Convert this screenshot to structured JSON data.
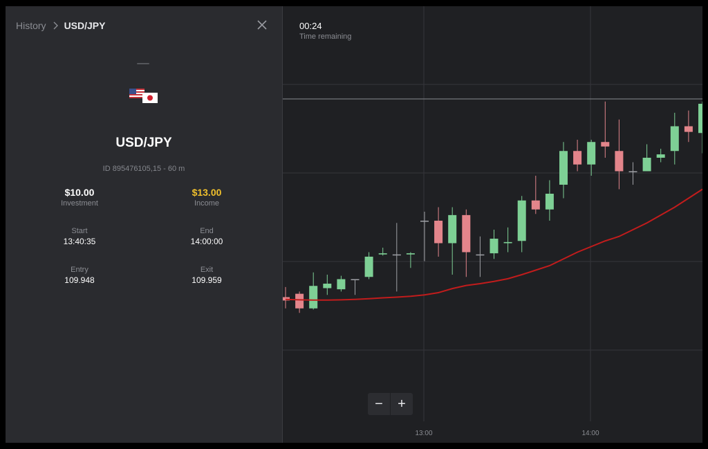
{
  "breadcrumb": {
    "root": "History",
    "current": "USD/JPY"
  },
  "icons": {
    "chevron": "chevron-right-icon",
    "close": "close-icon",
    "flags": "us-jp-flags-icon"
  },
  "trade": {
    "pair": "USD/JPY",
    "id_line": "ID 895476105,15 - 60 m",
    "investment": {
      "value": "$10.00",
      "label": "Investment"
    },
    "income": {
      "value": "$13.00",
      "label": "Income"
    },
    "start": {
      "label": "Start",
      "value": "13:40:35"
    },
    "end": {
      "label": "End",
      "value": "14:00:00"
    },
    "entry": {
      "label": "Entry",
      "value": "109.948"
    },
    "exit": {
      "label": "Exit",
      "value": "109.959"
    }
  },
  "timer": {
    "time": "00:24",
    "label": "Time remaining"
  },
  "zoom": {
    "minus": "−",
    "plus": "+"
  },
  "colors": {
    "up": "#7ed095",
    "down": "#e3858b",
    "ma": "#c21c1c",
    "income": "#f0c02c"
  },
  "chart_data": {
    "type": "candlestick",
    "x_tick_labels": [
      "13:00",
      "14:00"
    ],
    "candles": [
      {
        "o": 0.6,
        "c": 0.45,
        "h": 1.05,
        "l": 0.1
      },
      {
        "o": 0.75,
        "c": 0.1,
        "h": 0.85,
        "l": -0.1
      },
      {
        "o": 0.1,
        "c": 1.1,
        "h": 1.7,
        "l": 0.05
      },
      {
        "o": 1.0,
        "c": 1.2,
        "h": 1.6,
        "l": 0.7
      },
      {
        "o": 0.95,
        "c": 1.4,
        "h": 1.55,
        "l": 0.85
      },
      {
        "o": 1.4,
        "c": 1.4,
        "h": 1.4,
        "l": 0.7
      },
      {
        "o": 1.5,
        "c": 2.4,
        "h": 2.6,
        "l": 1.4
      },
      {
        "o": 2.5,
        "c": 2.55,
        "h": 2.8,
        "l": 2.45
      },
      {
        "o": 2.5,
        "c": 2.5,
        "h": 3.9,
        "l": 0.85
      },
      {
        "o": 2.5,
        "c": 2.55,
        "h": 2.6,
        "l": 1.9
      },
      {
        "o": 4.0,
        "c": 4.0,
        "h": 4.4,
        "l": 2.2
      },
      {
        "o": 4.0,
        "c": 3.0,
        "h": 4.6,
        "l": 2.4
      },
      {
        "o": 3.0,
        "c": 4.25,
        "h": 4.6,
        "l": 1.6
      },
      {
        "o": 4.25,
        "c": 2.6,
        "h": 4.5,
        "l": 1.5
      },
      {
        "o": 2.5,
        "c": 2.5,
        "h": 3.3,
        "l": 1.5
      },
      {
        "o": 2.55,
        "c": 3.2,
        "h": 3.6,
        "l": 2.3
      },
      {
        "o": 3.0,
        "c": 3.05,
        "h": 3.7,
        "l": 2.6
      },
      {
        "o": 3.1,
        "c": 4.9,
        "h": 5.1,
        "l": 2.6
      },
      {
        "o": 4.9,
        "c": 4.5,
        "h": 6.0,
        "l": 4.3
      },
      {
        "o": 4.5,
        "c": 5.2,
        "h": 5.8,
        "l": 4.0
      },
      {
        "o": 5.6,
        "c": 7.1,
        "h": 7.5,
        "l": 5.0
      },
      {
        "o": 7.1,
        "c": 6.5,
        "h": 7.6,
        "l": 6.2
      },
      {
        "o": 6.5,
        "c": 7.5,
        "h": 7.6,
        "l": 6.0
      },
      {
        "o": 7.5,
        "c": 7.3,
        "h": 9.3,
        "l": 6.8
      },
      {
        "o": 7.1,
        "c": 6.2,
        "h": 8.5,
        "l": 5.4
      },
      {
        "o": 6.2,
        "c": 6.2,
        "h": 6.6,
        "l": 5.6
      },
      {
        "o": 6.2,
        "c": 6.8,
        "h": 7.4,
        "l": 6.2
      },
      {
        "o": 6.8,
        "c": 6.95,
        "h": 7.2,
        "l": 6.6
      },
      {
        "o": 7.1,
        "c": 8.2,
        "h": 8.8,
        "l": 6.5
      },
      {
        "o": 8.2,
        "c": 7.95,
        "h": 8.9,
        "l": 7.5
      },
      {
        "o": 7.9,
        "c": 9.2,
        "h": 9.3,
        "l": 7.0
      }
    ],
    "moving_average": [
      0.5,
      0.48,
      0.47,
      0.47,
      0.48,
      0.5,
      0.53,
      0.57,
      0.6,
      0.64,
      0.7,
      0.8,
      0.98,
      1.12,
      1.2,
      1.3,
      1.42,
      1.6,
      1.8,
      2.0,
      2.3,
      2.6,
      2.85,
      3.1,
      3.3,
      3.6,
      3.9,
      4.25,
      4.6,
      5.0,
      5.4
    ]
  }
}
